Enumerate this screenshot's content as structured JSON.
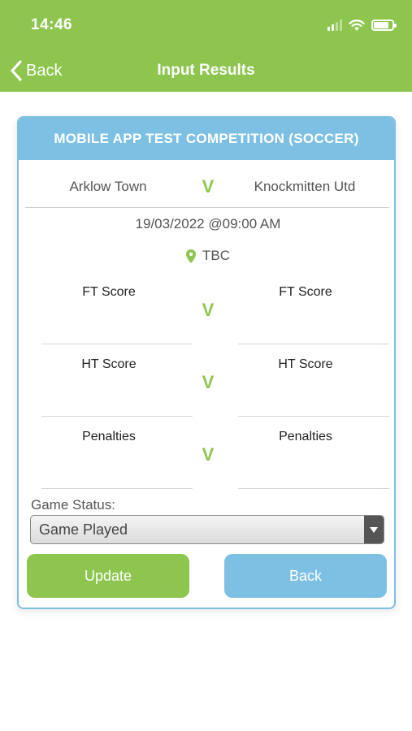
{
  "status_bar": {
    "time": "14:46"
  },
  "nav": {
    "back_label": "Back",
    "title": "Input Results"
  },
  "competition": {
    "title": "MOBILE APP TEST COMPETITION (SOCCER)"
  },
  "match": {
    "home_team": "Arklow Town",
    "away_team": "Knockmitten Utd",
    "versus": "V",
    "datetime": "19/03/2022 @09:00 AM",
    "venue": "TBC"
  },
  "scores": [
    {
      "home_label": "FT Score",
      "away_label": "FT Score",
      "versus": "V"
    },
    {
      "home_label": "HT Score",
      "away_label": "HT Score",
      "versus": "V"
    },
    {
      "home_label": "Penalties",
      "away_label": "Penalties",
      "versus": "V"
    }
  ],
  "game_status": {
    "label": "Game Status:",
    "selected": "Game Played"
  },
  "buttons": {
    "update": "Update",
    "back": "Back"
  },
  "colors": {
    "green": "#8dc54f",
    "blue": "#7ec0e4"
  },
  "icons": {
    "back": "chevron-left-icon",
    "venue": "map-pin-icon",
    "signal": "signal-icon",
    "wifi": "wifi-icon",
    "battery": "battery-icon",
    "dropdown": "caret-down-icon"
  }
}
